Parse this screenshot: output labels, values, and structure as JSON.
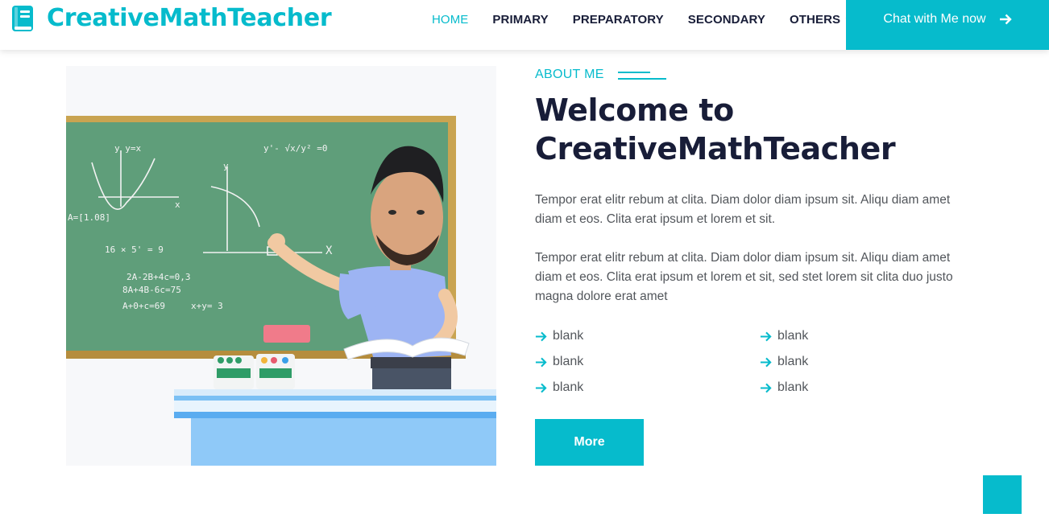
{
  "brand": {
    "name": "CreativeMathTeacher",
    "icon": "book-icon"
  },
  "nav": {
    "items": [
      {
        "label": "HOME",
        "active": true
      },
      {
        "label": "PRIMARY"
      },
      {
        "label": "PREPARATORY"
      },
      {
        "label": "SECONDARY"
      },
      {
        "label": "OTHERS",
        "dropdown": true
      }
    ],
    "cta": {
      "label": "Chat with Me now",
      "icon": "arrow-right-icon"
    }
  },
  "about": {
    "tag": "ABOUT ME",
    "title_line1": "Welcome to",
    "title_line2": "CreativeMathTeacher",
    "paragraph1": "Tempor erat elitr rebum at clita. Diam dolor diam ipsum sit. Aliqu diam amet diam et eos. Clita erat ipsum et lorem et sit.",
    "paragraph2": "Tempor erat elitr rebum at clita. Diam dolor diam ipsum sit. Aliqu diam amet diam et eos. Clita erat ipsum et lorem et sit, sed stet lorem sit clita duo justo magna dolore erat amet",
    "bullets": [
      "blank",
      "blank",
      "blank",
      "blank",
      "blank",
      "blank"
    ],
    "button": "More"
  },
  "board": {
    "line1": "y  y=x",
    "line2": "y'-  √x/y² =0",
    "line3": "A=[1.08]",
    "line4": "16 × 5' = 9",
    "line5": "2A-2B+4c=0,3",
    "line6": "8A+4B-6c=75",
    "line7": "A+0+c=69",
    "line8": "x+y= 3",
    "axis_x": "x",
    "axis_y": "y",
    "axis_X": "X"
  },
  "colors": {
    "accent": "#06bbcc",
    "dark": "#181d38",
    "text": "#52565b"
  }
}
